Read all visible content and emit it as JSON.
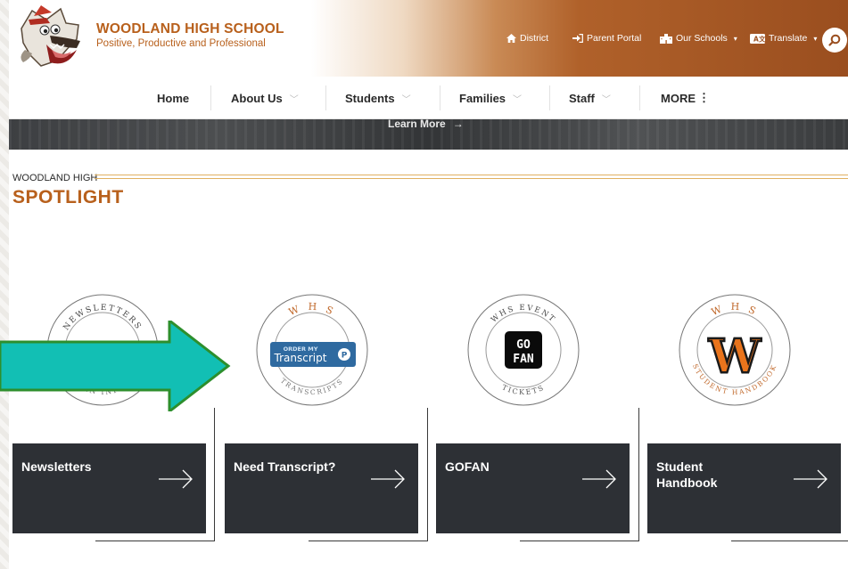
{
  "header": {
    "school_name": "WOODLAND HIGH SCHOOL",
    "tagline": "Positive, Productive and Professional",
    "utility_links": [
      {
        "label": "District",
        "icon": "home-icon"
      },
      {
        "label": "Parent Portal",
        "icon": "sign-in-icon"
      },
      {
        "label": "Our Schools",
        "icon": "building-icon",
        "dropdown": "▾"
      },
      {
        "label": "Translate",
        "icon": "translate-icon",
        "dropdown": "▾"
      }
    ],
    "search_icon": "search-icon"
  },
  "nav": {
    "items": [
      {
        "label": "Home",
        "dropdown": ""
      },
      {
        "label": "About Us",
        "dropdown": "﹀"
      },
      {
        "label": "Students",
        "dropdown": "﹀"
      },
      {
        "label": "Families",
        "dropdown": "﹀"
      },
      {
        "label": "Staff",
        "dropdown": "﹀"
      },
      {
        "label": "MORE",
        "dropdown": "⋮"
      }
    ]
  },
  "hero": {
    "link_label": "Learn More",
    "link_arrow": "→"
  },
  "spotlight": {
    "eyebrow": "WOODLAND HIGH",
    "title": "SPOTLIGHT",
    "cards": [
      {
        "title": "Newsletters",
        "seal": {
          "top_text": "NEWSLETTERS",
          "bottom_text": "BULLETIN INFORMATI"
        }
      },
      {
        "title": "Need Transcript?",
        "seal": {
          "top_text": "W H S",
          "bottom_text": "TRANSCRIPTS",
          "badge_small": "ORDER MY",
          "badge_big": "Transcript",
          "badge_icon": "P"
        }
      },
      {
        "title": "GOFAN",
        "seal": {
          "top_text": "WHS EVENT",
          "bottom_text": "TICKETS",
          "logo_top": "GO",
          "logo_bottom": "FAN"
        }
      },
      {
        "title": "Student Handbook",
        "seal": {
          "top_text": "W H S",
          "bottom_text": "STUDENT HANDBOOK",
          "letter": "W"
        }
      }
    ]
  },
  "colors": {
    "brand_orange": "#b8601c",
    "card_bg": "#2d3035",
    "callout_teal": "#12bfb4"
  }
}
